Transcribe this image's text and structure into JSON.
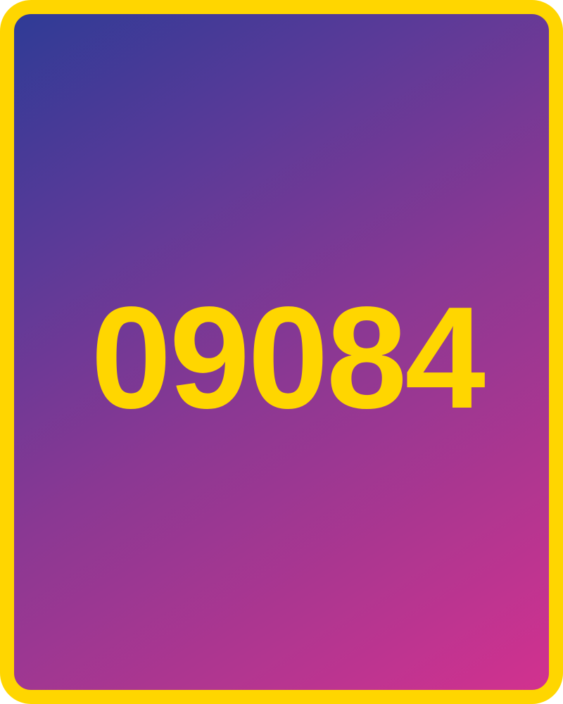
{
  "card": {
    "number": "09084",
    "colors": {
      "border": "#FFD600",
      "text": "#FFD600",
      "gradient_start": "#2f3b96",
      "gradient_end": "#d2318f"
    }
  }
}
